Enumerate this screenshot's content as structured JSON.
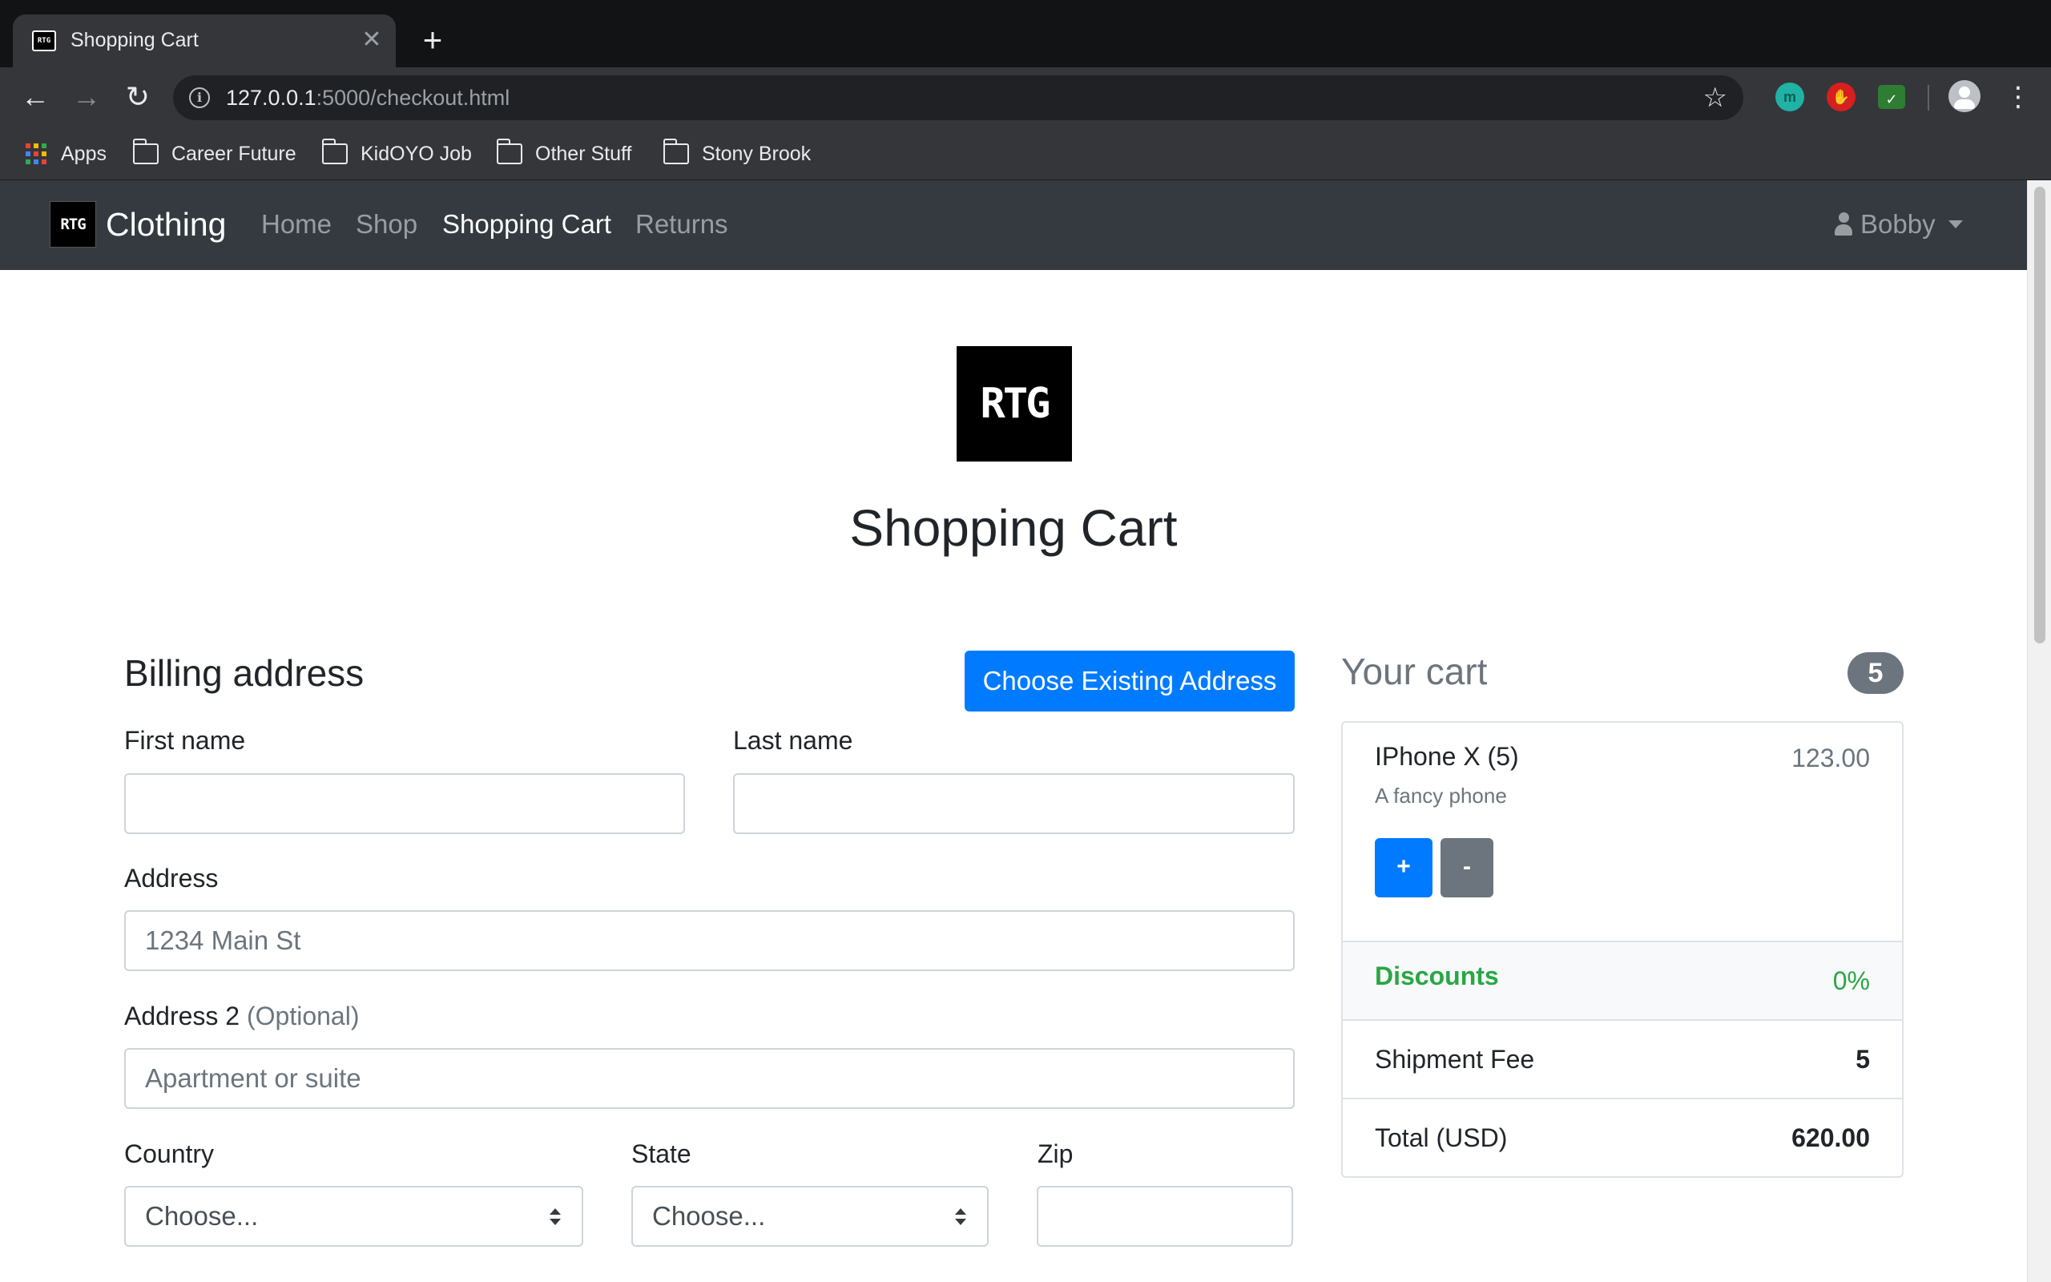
{
  "browser": {
    "tab_title": "Shopping Cart",
    "tab_favicon_text": "RTG",
    "url_host": "127.0.0.1",
    "url_rest": ":5000/checkout.html",
    "bookmarks": [
      {
        "label": "Apps",
        "icon": "apps-grid-icon"
      },
      {
        "label": "Career Future",
        "icon": "folder-icon"
      },
      {
        "label": "KidOYO Job",
        "icon": "folder-icon"
      },
      {
        "label": "Other Stuff",
        "icon": "folder-icon"
      },
      {
        "label": "Stony Brook",
        "icon": "folder-icon"
      }
    ],
    "extension_m_label": "m"
  },
  "navbar": {
    "logo_text": "RTG",
    "brand": "Clothing",
    "links": [
      "Home",
      "Shop",
      "Shopping Cart",
      "Returns"
    ],
    "active_link": "Shopping Cart",
    "user_name": "Bobby"
  },
  "hero": {
    "logo_text": "RTG",
    "title": "Shopping Cart"
  },
  "billing": {
    "heading": "Billing address",
    "choose_button": "Choose Existing Address",
    "first_name_label": "First name",
    "first_name_value": "",
    "last_name_label": "Last name",
    "last_name_value": "",
    "address_label": "Address",
    "address_placeholder": "1234 Main St",
    "address2_label": "Address 2",
    "address2_optional": "(Optional)",
    "address2_placeholder": "Apartment or suite",
    "country_label": "Country",
    "country_value": "Choose...",
    "state_label": "State",
    "state_value": "Choose...",
    "zip_label": "Zip",
    "zip_value": ""
  },
  "cart": {
    "heading": "Your cart",
    "count": "5",
    "items": [
      {
        "name": "IPhone X (5)",
        "description": "A fancy phone",
        "price": "123.00"
      }
    ],
    "plus_label": "+",
    "minus_label": "-",
    "discount_label": "Discounts",
    "discount_value": "0%",
    "shipment_label": "Shipment Fee",
    "shipment_value": "5",
    "total_label": "Total (USD)",
    "total_value": "620.00"
  },
  "colors": {
    "navbar_bg": "#343a40",
    "primary": "#007bff",
    "secondary": "#6c757d",
    "success": "#28a745"
  }
}
